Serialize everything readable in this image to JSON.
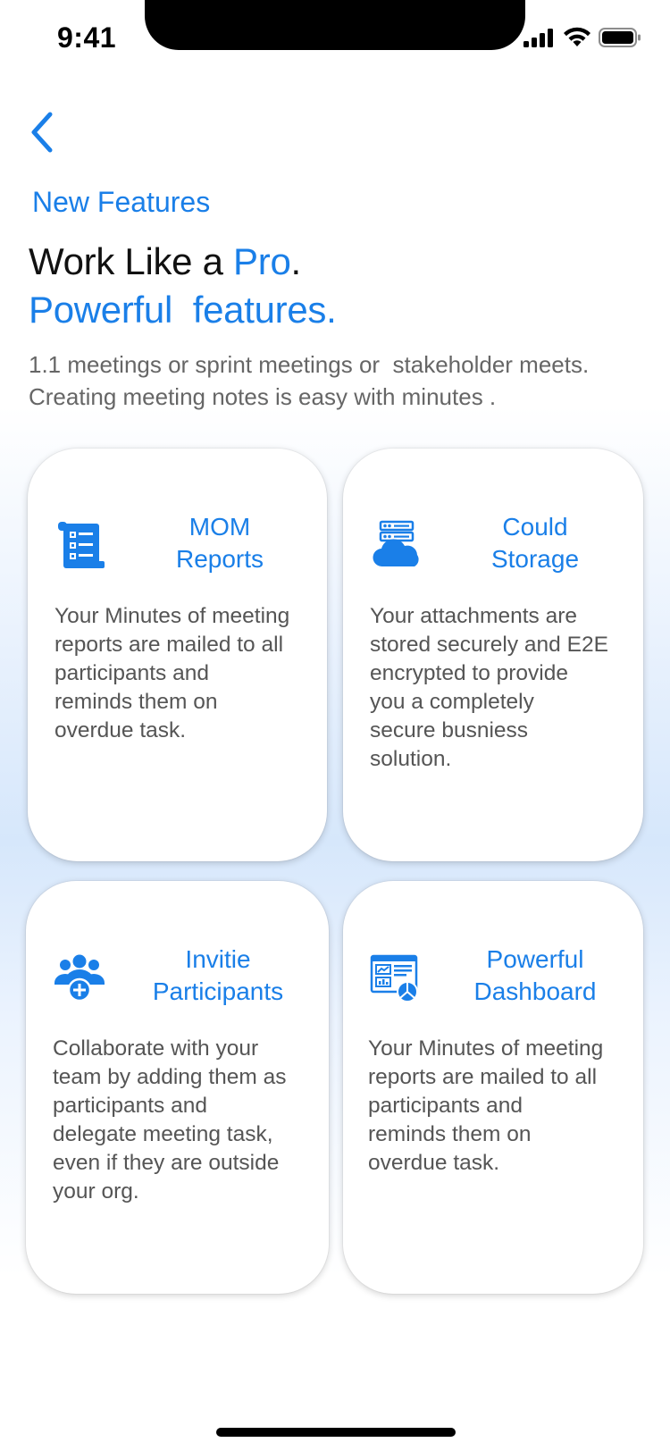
{
  "status_bar": {
    "time": "9:41"
  },
  "header": {
    "eyebrow": "New Features",
    "headline_line1_prefix": "Work Like a ",
    "headline_line1_accent": "Pro",
    "headline_line1_suffix": ".",
    "headline_line2": "Powerful  features.",
    "subtext_line1": "1.1 meetings or sprint meetings or  stakeholder meets.",
    "subtext_line2": "Creating meeting notes is easy with minutes ."
  },
  "cards": [
    {
      "icon": "report-icon",
      "title_line1": "MOM",
      "title_line2": "Reports",
      "body": [
        "Your Minutes of meeting",
        "reports are mailed to all",
        "participants and",
        "reminds them on",
        "overdue task."
      ]
    },
    {
      "icon": "cloud-storage-icon",
      "title_line1": "Could",
      "title_line2": "Storage",
      "body": [
        "Your attachments are",
        "stored securely and E2E",
        "encrypted to provide",
        "you a completely",
        "secure busniess",
        "solution."
      ]
    },
    {
      "icon": "invite-participants-icon",
      "title_line1": "Invitie",
      "title_line2": "Participants",
      "body": [
        "Collaborate with your",
        "team by adding them as",
        "participants and",
        "delegate meeting task,",
        "even if they are outside",
        "your org."
      ]
    },
    {
      "icon": "dashboard-icon",
      "title_line1": "Powerful",
      "title_line2": "Dashboard",
      "body": [
        "Your Minutes of meeting",
        "reports are mailed to all",
        "participants and",
        "reminds them on",
        "overdue task."
      ]
    }
  ],
  "colors": {
    "accent": "#1a7fe8",
    "text": "#111111",
    "muted": "#666666"
  }
}
